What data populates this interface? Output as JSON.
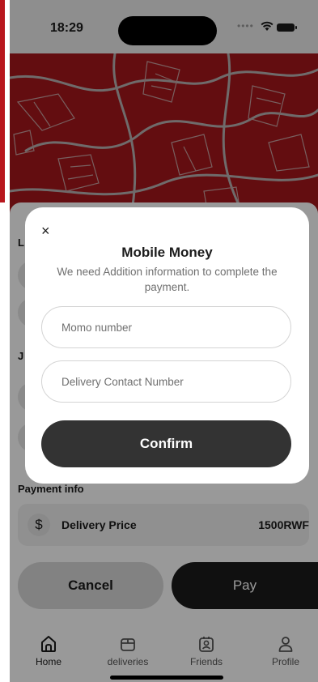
{
  "status_bar": {
    "time": "18:29"
  },
  "sections": {
    "location_initial": "L",
    "journey_initial": "J",
    "payment_info": "Payment info"
  },
  "payment": {
    "delivery_price_label": "Delivery Price",
    "delivery_price_value": "1500RWF",
    "currency_symbol": "$"
  },
  "actions": {
    "cancel_label": "Cancel",
    "pay_label": "Pay"
  },
  "tabbar": {
    "items": [
      {
        "label": "Home",
        "icon": "home-icon",
        "active": true
      },
      {
        "label": "deliveries",
        "icon": "package-icon",
        "active": false
      },
      {
        "label": "Friends",
        "icon": "contact-icon",
        "active": false
      },
      {
        "label": "Profile",
        "icon": "user-icon",
        "active": false
      }
    ]
  },
  "modal": {
    "close_symbol": "×",
    "title": "Mobile Money",
    "subtitle": "We need Addition information to complete the payment.",
    "momo_placeholder": "Momo number",
    "contact_placeholder": "Delivery Contact Number",
    "confirm_label": "Confirm"
  },
  "colors": {
    "map_red": "#a5171b",
    "primary_dark": "#333333",
    "overlay": "rgba(0,0,0,0.40)"
  }
}
